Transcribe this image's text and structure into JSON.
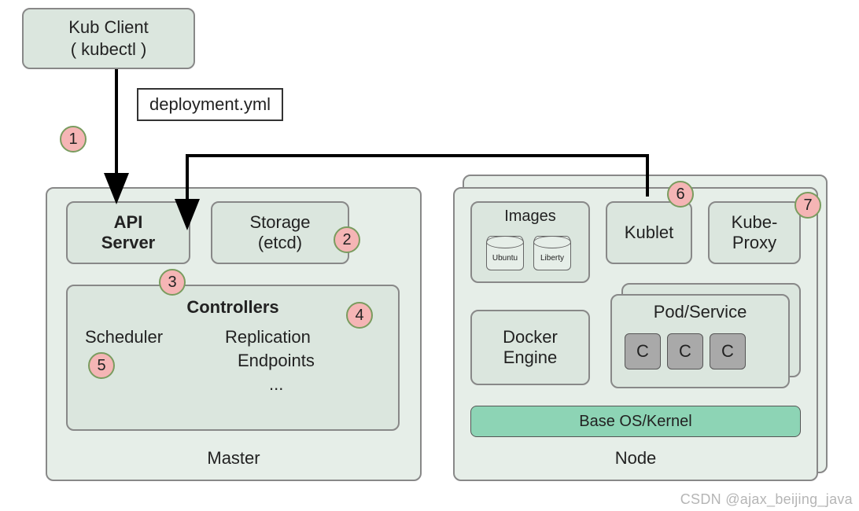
{
  "client": {
    "line1": "Kub Client",
    "line2": "( kubectl )"
  },
  "deployment_file": "deployment.yml",
  "master": {
    "title": "Master",
    "api_server": {
      "line1": "API",
      "line2": "Server"
    },
    "storage": {
      "line1": "Storage",
      "line2": "(etcd)"
    },
    "controllers": {
      "title": "Controllers",
      "scheduler": "Scheduler",
      "replication": "Replication",
      "endpoints": "Endpoints",
      "more": "..."
    }
  },
  "node": {
    "title": "Node",
    "images": {
      "title": "Images",
      "img1": "Ubuntu",
      "img2": "Liberty"
    },
    "kublet": "Kublet",
    "kubeproxy": {
      "line1": "Kube-",
      "line2": "Proxy"
    },
    "docker": {
      "line1": "Docker",
      "line2": "Engine"
    },
    "pod": {
      "title": "Pod/Service",
      "c": "C"
    },
    "os": "Base OS/Kernel"
  },
  "badges": {
    "b1": "1",
    "b2": "2",
    "b3": "3",
    "b4": "4",
    "b5": "5",
    "b6": "6",
    "b7": "7"
  },
  "watermark": "CSDN @ajax_beijing_java"
}
